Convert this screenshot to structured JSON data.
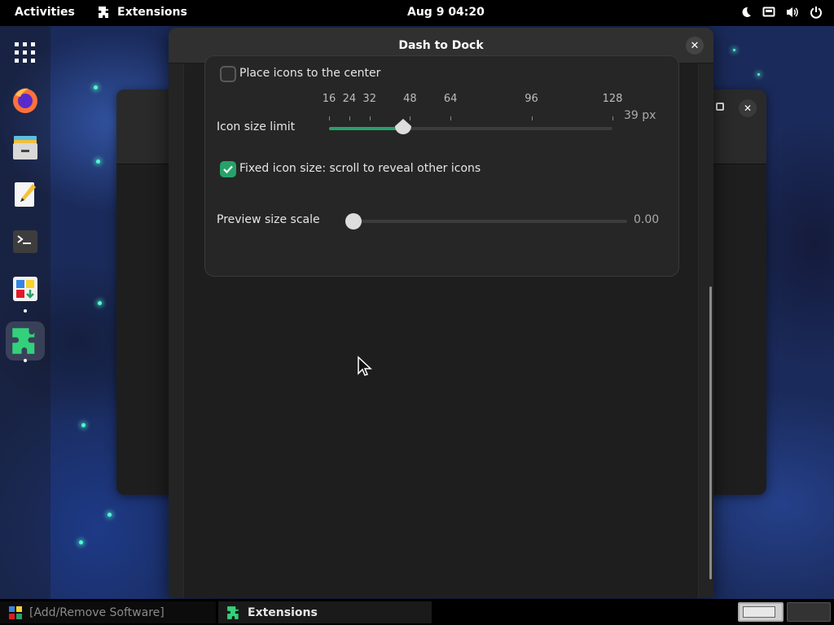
{
  "topbar": {
    "activities": "Activities",
    "app_menu": "Extensions",
    "clock": "Aug 9  04:20"
  },
  "dock": {
    "items": [
      "app-grid",
      "firefox",
      "files",
      "text-editor",
      "terminal",
      "software",
      "extensions"
    ]
  },
  "dialog": {
    "title": "Dash to Dock",
    "close_label": "✕",
    "settings": {
      "place_center": {
        "label": "Place icons to the center",
        "checked": false
      },
      "icon_size": {
        "label": "Icon size limit",
        "marks": [
          "16",
          "24",
          "32",
          "48",
          "64",
          "96",
          "128"
        ],
        "value": 39,
        "value_text": "39 px"
      },
      "fixed_icon": {
        "label": "Fixed icon size: scroll to reveal other icons",
        "checked": true
      },
      "preview_scale": {
        "label": "Preview size scale",
        "value": 0.0,
        "value_text": "0.00"
      }
    }
  },
  "taskbar": {
    "tasks": [
      {
        "label": "[Add/Remove Software]",
        "active": false
      },
      {
        "label": "Extensions",
        "active": true
      }
    ]
  },
  "colors": {
    "accent": "#26a269",
    "dialog_bg": "#242424",
    "topbar_bg": "#000000"
  }
}
